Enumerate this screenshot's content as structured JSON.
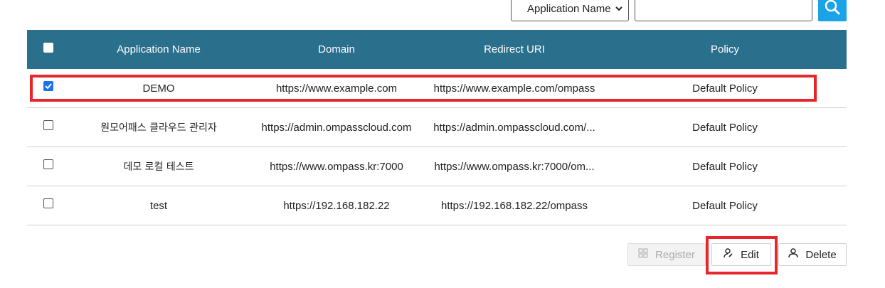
{
  "search": {
    "field_select": "Application Name",
    "query": ""
  },
  "table": {
    "headers": [
      "Application Name",
      "Domain",
      "Redirect URI",
      "Policy"
    ],
    "rows": [
      {
        "name": "DEMO",
        "domain": "https://www.example.com",
        "redirect": "https://www.example.com/ompass",
        "policy": "Default Policy",
        "checked": true
      },
      {
        "name": "원모어패스 클라우드 관리자",
        "domain": "https://admin.ompasscloud.com",
        "redirect": "https://admin.ompasscloud.com/...",
        "policy": "Default Policy",
        "checked": false
      },
      {
        "name": "데모 로컬 테스트",
        "domain": "https://www.ompass.kr:7000",
        "redirect": "https://www.ompass.kr:7000/om...",
        "policy": "Default Policy",
        "checked": false
      },
      {
        "name": "test",
        "domain": "https://192.168.182.22",
        "redirect": "https://192.168.182.22/ompass",
        "policy": "Default Policy",
        "checked": false
      }
    ]
  },
  "actions": {
    "register_label": "Register",
    "edit_label": "Edit",
    "delete_label": "Delete"
  },
  "colors": {
    "header_bg": "#2a6f8c",
    "search_button": "#1aa3e6",
    "highlight": "#e6262a",
    "checkbox_checked": "#1a73e8"
  },
  "icons": {
    "search": "search-icon",
    "register": "register-icon",
    "edit": "user-edit-icon",
    "delete": "user-icon"
  }
}
